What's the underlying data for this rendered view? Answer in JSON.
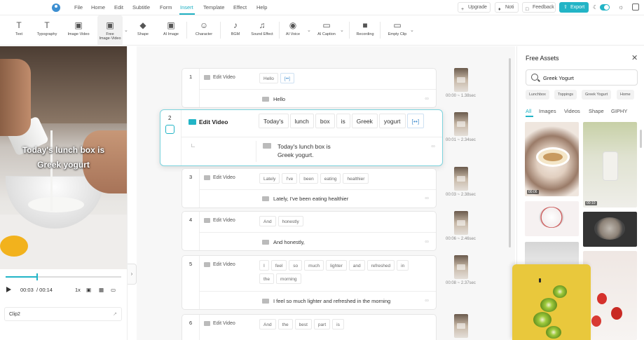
{
  "menu": {
    "items": [
      "File",
      "Home",
      "Edit",
      "Subtitle",
      "Form",
      "Insert",
      "Template",
      "Effect",
      "Help"
    ],
    "active": "Insert",
    "upgrade": "Upgrade",
    "noti": "Noti",
    "feedback": "Feedback",
    "export": "Export"
  },
  "toolbar": {
    "items": [
      {
        "label": "Text",
        "icon": "T"
      },
      {
        "label": "Typography",
        "icon": "T"
      },
      {
        "label": "Image·Video",
        "icon": "▣"
      },
      {
        "label": "Free Image·Video",
        "icon": "▣",
        "line1": "Free",
        "line2": "Image·Video"
      },
      {
        "label": "Shape",
        "icon": "◆"
      },
      {
        "label": "AI Image",
        "icon": "▣"
      },
      {
        "label": "Character",
        "icon": "☺"
      },
      {
        "label": "BGM",
        "icon": "♪"
      },
      {
        "label": "Sound Effect",
        "icon": "♫"
      },
      {
        "label": "AI Voice",
        "icon": "◉"
      },
      {
        "label": "AI Caption",
        "icon": "▭"
      },
      {
        "label": "Recording",
        "icon": "■"
      },
      {
        "label": "Empty Clip",
        "icon": "▭"
      }
    ]
  },
  "preview": {
    "caption_line1": "Today's lunch box is",
    "caption_line2": "Greek yogurt",
    "current_time": "00:03",
    "total_time": "/ 00:14",
    "speed": "1x",
    "progress": 0.27,
    "clip_name": "Clip2"
  },
  "rows": [
    {
      "num": "1",
      "label": "Edit Video",
      "words": [
        "Hello",
        "[••]"
      ],
      "caption": "Hello",
      "time": "00:00 ~ 1.38sec"
    },
    {
      "num": "2",
      "label": "Edit Video",
      "words": [
        "Today's",
        "lunch",
        "box",
        "is",
        "Greek",
        "yogurt",
        "[••]"
      ],
      "caption_line1": "Today's lunch box is",
      "caption_line2": "Greek yogurt.",
      "time": "00:01 ~ 2.34sec"
    },
    {
      "num": "3",
      "label": "Edit Video",
      "words": [
        "Lately",
        "I've",
        "been",
        "eating",
        "healthier"
      ],
      "caption": "Lately, I've been eating healthier",
      "time": "00:03 ~ 2.38sec"
    },
    {
      "num": "4",
      "label": "Edit Video",
      "words": [
        "And",
        "honestly"
      ],
      "caption": "And honestly,",
      "time": "00:06 ~ 2.46sec"
    },
    {
      "num": "5",
      "label": "Edit Video",
      "words": [
        "I",
        "feel",
        "so",
        "much",
        "lighter",
        "and",
        "refreshed",
        "in",
        "the",
        "morning"
      ],
      "caption": "I feel so much lighter and refreshed in the morning",
      "time": "00:08 ~ 2.37sec"
    },
    {
      "num": "6",
      "label": "Edit Video",
      "words": [
        "And",
        "the",
        "best",
        "part",
        "is"
      ]
    }
  ],
  "assets": {
    "title": "Free Assets",
    "search_value": "Greek Yogurt",
    "chips": [
      "Lunchbox",
      "Toppings",
      "Greek Yogurt",
      "Home"
    ],
    "tabs": [
      "All",
      "Images",
      "Videos",
      "Shape",
      "GIPHY"
    ],
    "active_tab": "All",
    "durations": [
      "00:06",
      "00:10"
    ]
  }
}
